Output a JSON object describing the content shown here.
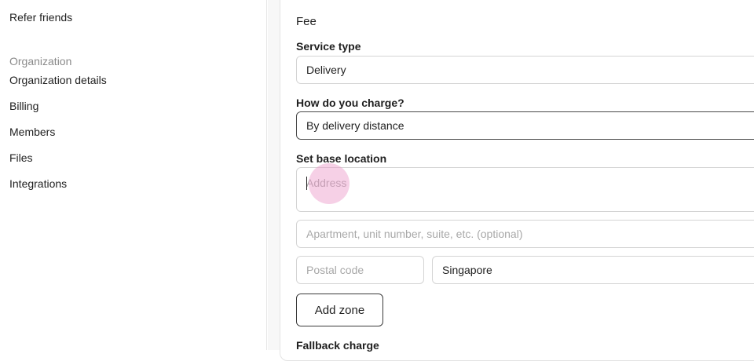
{
  "sidebar": {
    "refer_friends": "Refer friends",
    "org_heading": "Organization",
    "items": [
      {
        "label": "Organization details"
      },
      {
        "label": "Billing"
      },
      {
        "label": "Members"
      },
      {
        "label": "Files"
      },
      {
        "label": "Integrations"
      }
    ]
  },
  "fee": {
    "title": "Fee",
    "service_type_label": "Service type",
    "service_type_value": "Delivery",
    "charge_label": "How do you charge?",
    "charge_value": "By delivery distance",
    "base_location_label": "Set base location",
    "address_placeholder": "Address",
    "apartment_placeholder": "Apartment, unit number, suite, etc. (optional)",
    "postal_placeholder": "Postal code",
    "country_value": "Singapore",
    "add_zone_label": "Add zone",
    "fallback_label": "Fallback charge"
  },
  "colors": {
    "click_indicator": "#ec96c8",
    "border": "#d4d4d4",
    "focused_border": "#4a4a4a"
  }
}
